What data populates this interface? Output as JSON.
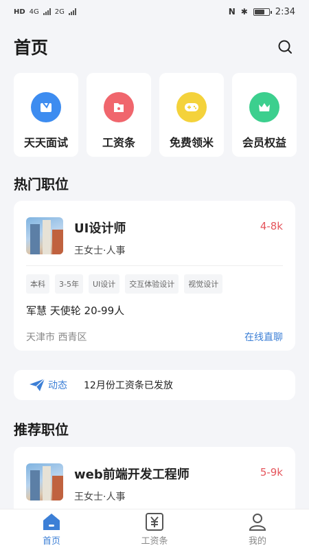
{
  "status_bar": {
    "network": "HD",
    "signal_1": "4G",
    "signal_2": "2G",
    "time": "2:34",
    "battery_level": 0.75
  },
  "header": {
    "title": "首页"
  },
  "quick_actions": [
    {
      "label": "天天面试",
      "icon": "interview-icon",
      "color": "#3d8cf0"
    },
    {
      "label": "工资条",
      "icon": "payslip-icon",
      "color": "#f0666d"
    },
    {
      "label": "免费领米",
      "icon": "gamepad-icon",
      "color": "#f4d23b"
    },
    {
      "label": "会员权益",
      "icon": "crown-icon",
      "color": "#3ccf8e"
    }
  ],
  "hot_section": {
    "title": "热门职位"
  },
  "hot_job": {
    "title": "UI设计师",
    "contact": "王女士·人事",
    "salary": "4-8k",
    "tags": [
      "本科",
      "3-5年",
      "UI设计",
      "交互体验设计",
      "视觉设计"
    ],
    "company": "军慧 天使轮 20-99人",
    "location": "天津市 西青区",
    "chat_label": "在线直聊"
  },
  "news": {
    "label": "动态",
    "text": "12月份工资条已发放"
  },
  "recommend_section": {
    "title": "推荐职位"
  },
  "recommend_job": {
    "title": "web前端开发工程师",
    "contact": "王女士·人事",
    "salary": "5-9k"
  },
  "tab_bar": [
    {
      "label": "首页",
      "icon": "home-icon",
      "active": true
    },
    {
      "label": "工资条",
      "icon": "yuan-icon",
      "active": false
    },
    {
      "label": "我的",
      "icon": "profile-icon",
      "active": false
    }
  ],
  "colors": {
    "accent": "#3c7fd6",
    "salary": "#e5555c"
  }
}
